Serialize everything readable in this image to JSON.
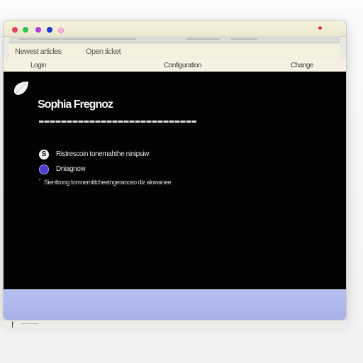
{
  "window": {
    "toolbar": {
      "left_label": "Newest articles",
      "right_label": "Open ticket"
    },
    "address_bar": {
      "left_label": "Login",
      "center_label": "Configuration",
      "right_label": "Change"
    }
  },
  "content": {
    "heading": "Sophia Fregnoz",
    "rows": [
      {
        "label": "Ristrescoin tonemahthe ninipsiw"
      },
      {
        "label": "Dniagnow"
      }
    ],
    "footnote": {
      "mark": "'",
      "text": "Sienttrong tomnernittcheetngeranceo diz alowanee"
    }
  },
  "bottom": {
    "mark": "f"
  },
  "colors": {
    "traffic_red": "#e0455a",
    "traffic_green": "#2fc14e",
    "traffic_purple": "#b23be0",
    "traffic_blue": "#2036d6",
    "accent_blue": "#a6b0e6",
    "content_bg": "#030303"
  },
  "icons": {
    "window_controls": [
      "close-icon",
      "minimize-icon",
      "zoom-icon",
      "extra-control-icon"
    ],
    "brand_icon": "leaf-icon",
    "row_icons": [
      "s-letter-icon",
      "circle-icon"
    ]
  }
}
